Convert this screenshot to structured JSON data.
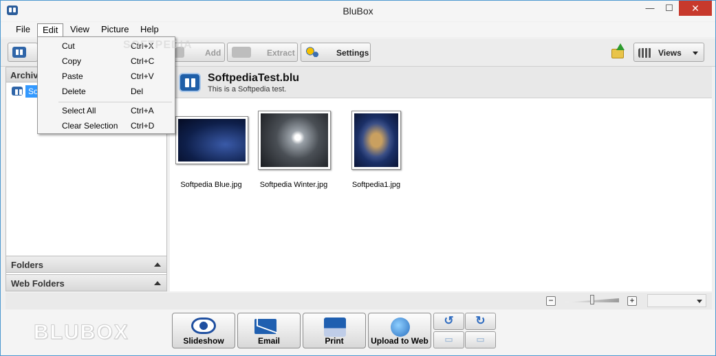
{
  "window": {
    "title": "BluBox"
  },
  "window_controls": {
    "minimize": "—",
    "maximize": "☐",
    "close": "✕"
  },
  "menubar": {
    "items": [
      "File",
      "Edit",
      "View",
      "Picture",
      "Help"
    ]
  },
  "toolbar": {
    "add": "Add",
    "extract": "Extract",
    "settings": "Settings",
    "views": "Views"
  },
  "left_panel": {
    "header": "Archive",
    "tree_item": "Soft",
    "folders": "Folders",
    "web_folders": "Web Folders"
  },
  "archive": {
    "name": "SoftpediaTest.blu",
    "description": "This is a Softpedia test."
  },
  "thumbnails": [
    {
      "label": "Softpedia Blue.jpg",
      "color": "#0e1f4a"
    },
    {
      "label": "Softpedia Winter.jpg",
      "color": "#4a4f55"
    },
    {
      "label": "Softpedia1.jpg",
      "color": "#1a2f66"
    }
  ],
  "zoom": {
    "minus": "−",
    "plus": "+"
  },
  "bottom": {
    "logo": "BLUBOX",
    "slideshow": "Slideshow",
    "email": "Email",
    "print": "Print",
    "upload": "Upload to Web",
    "rotate_left": "↺",
    "rotate_right": "↻"
  },
  "edit_menu": {
    "items": [
      {
        "label": "Cut",
        "shortcut": "Ctrl+X"
      },
      {
        "label": "Copy",
        "shortcut": "Ctrl+C"
      },
      {
        "label": "Paste",
        "shortcut": "Ctrl+V"
      },
      {
        "label": "Delete",
        "shortcut": "Del"
      },
      {
        "label": "Select All",
        "shortcut": "Ctrl+A"
      },
      {
        "label": "Clear Selection",
        "shortcut": "Ctrl+D"
      }
    ]
  },
  "watermark": "SOFTPEDIA",
  "colors": {
    "accent": "#3399ff",
    "brand": "#1f5fa8",
    "close": "#c7392c"
  }
}
